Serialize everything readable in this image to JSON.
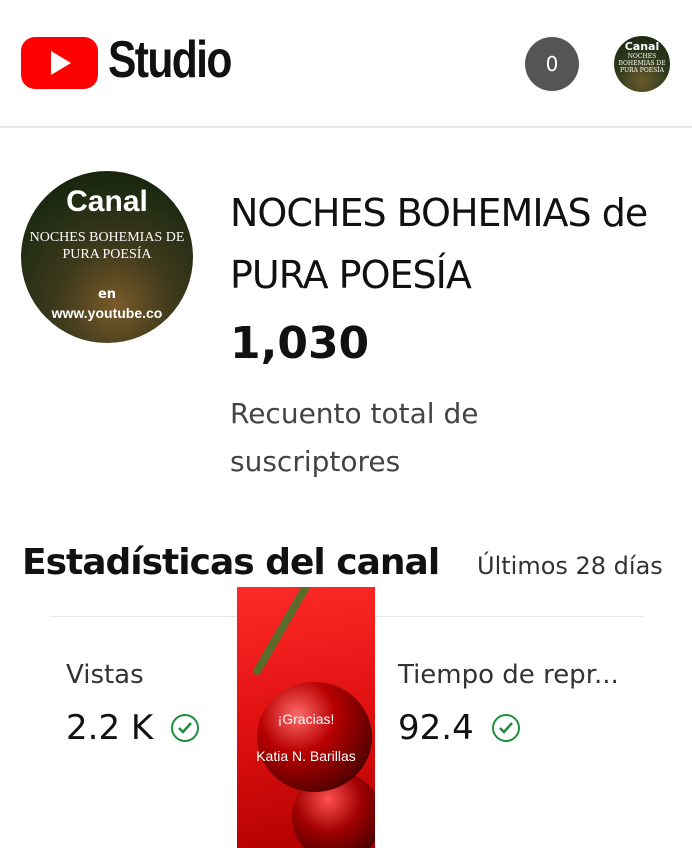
{
  "header": {
    "app_name": "Studio",
    "notification_count": "0",
    "avatar_text": {
      "line1": "Canal",
      "line2": "NOCHES BOHEMIAS DE PURA POESÍA"
    }
  },
  "channel": {
    "avatar_text": {
      "line1": "Canal",
      "line2": "NOCHES BOHEMIAS DE PURA POESÍA",
      "line3": "en",
      "line4": "www.youtube.co"
    },
    "name": "NOCHES BOHEMIAS de PURA POESÍA",
    "subscribers": "1,030",
    "subscribers_label": "Recuento total de suscriptores"
  },
  "stats": {
    "title": "Estadísticas del canal",
    "period": "Últimos 28 días",
    "metrics": [
      {
        "label": "Vistas",
        "value": "2.2 K"
      },
      {
        "label": "Tiempo de repr...",
        "value": "92.4"
      }
    ]
  },
  "overlay": {
    "line1": "¡Gracias!",
    "line2": "Katia N. Barillas"
  },
  "colors": {
    "brand": "#ff0000",
    "check": "#1e8e3e"
  }
}
